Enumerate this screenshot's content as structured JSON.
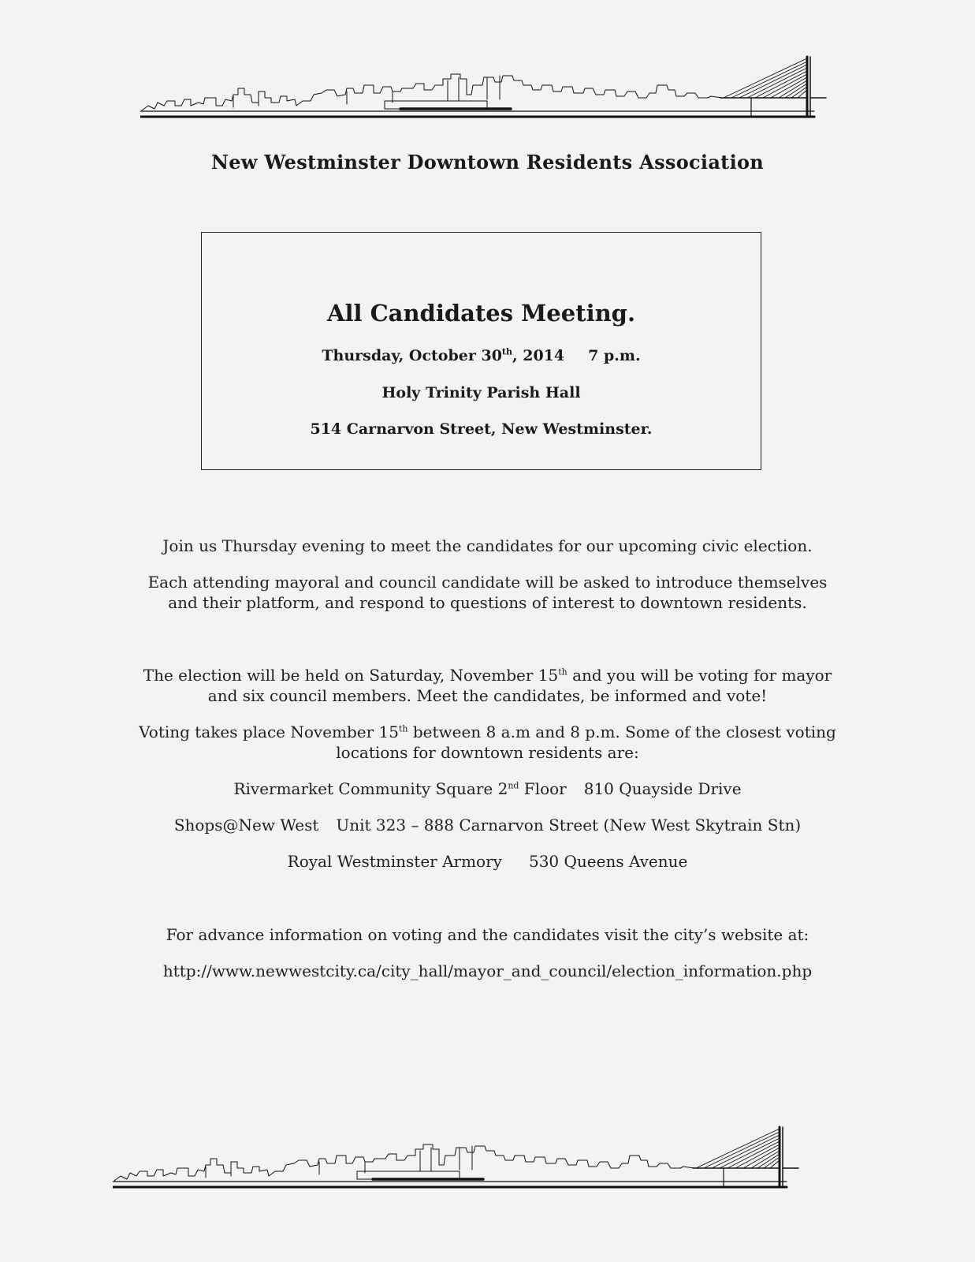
{
  "organization": "New Westminster Downtown Residents Association",
  "meeting": {
    "title": "All Candidates Meeting.",
    "date_prefix": "Thursday, October 30",
    "date_sup": "th",
    "date_suffix": ", 2014",
    "time": "7 p.m.",
    "venue": "Holy Trinity Parish Hall",
    "address": "514 Carnarvon Street, New Westminster."
  },
  "body": {
    "join": "Join us Thursday evening to meet the candidates for our upcoming civic election.",
    "each_1": "Each attending mayoral and council candidate will be asked to introduce themselves",
    "each_2": "and their platform, and respond to questions of interest to downtown residents.",
    "election_1a": "The election will be held on Saturday, November 15",
    "election_1sup": "th",
    "election_1b": " and you will be voting for mayor",
    "election_2": "and six council members. Meet the candidates, be informed and vote!",
    "voting_1a": "Voting takes place November 15",
    "voting_1sup": "th",
    "voting_1b": " between 8 a.m and 8 p.m. Some of the closest voting",
    "voting_2": "locations for downtown residents are:"
  },
  "locations": [
    {
      "name_a": "Rivermarket Community Square  2",
      "name_sup": "nd",
      "name_b": " Floor",
      "address": "810 Quayside Drive"
    },
    {
      "name": "Shops@New West",
      "address": "Unit 323 – 888 Carnarvon Street (New West Skytrain Stn)"
    },
    {
      "name": "Royal Westminster Armory",
      "address": "530 Queens Avenue"
    }
  ],
  "advance": {
    "text": "For advance information on voting and the candidates visit the city’s website at:",
    "url": "http://www.newwestcity.ca/city_hall/mayor_and_council/election_information.php"
  }
}
